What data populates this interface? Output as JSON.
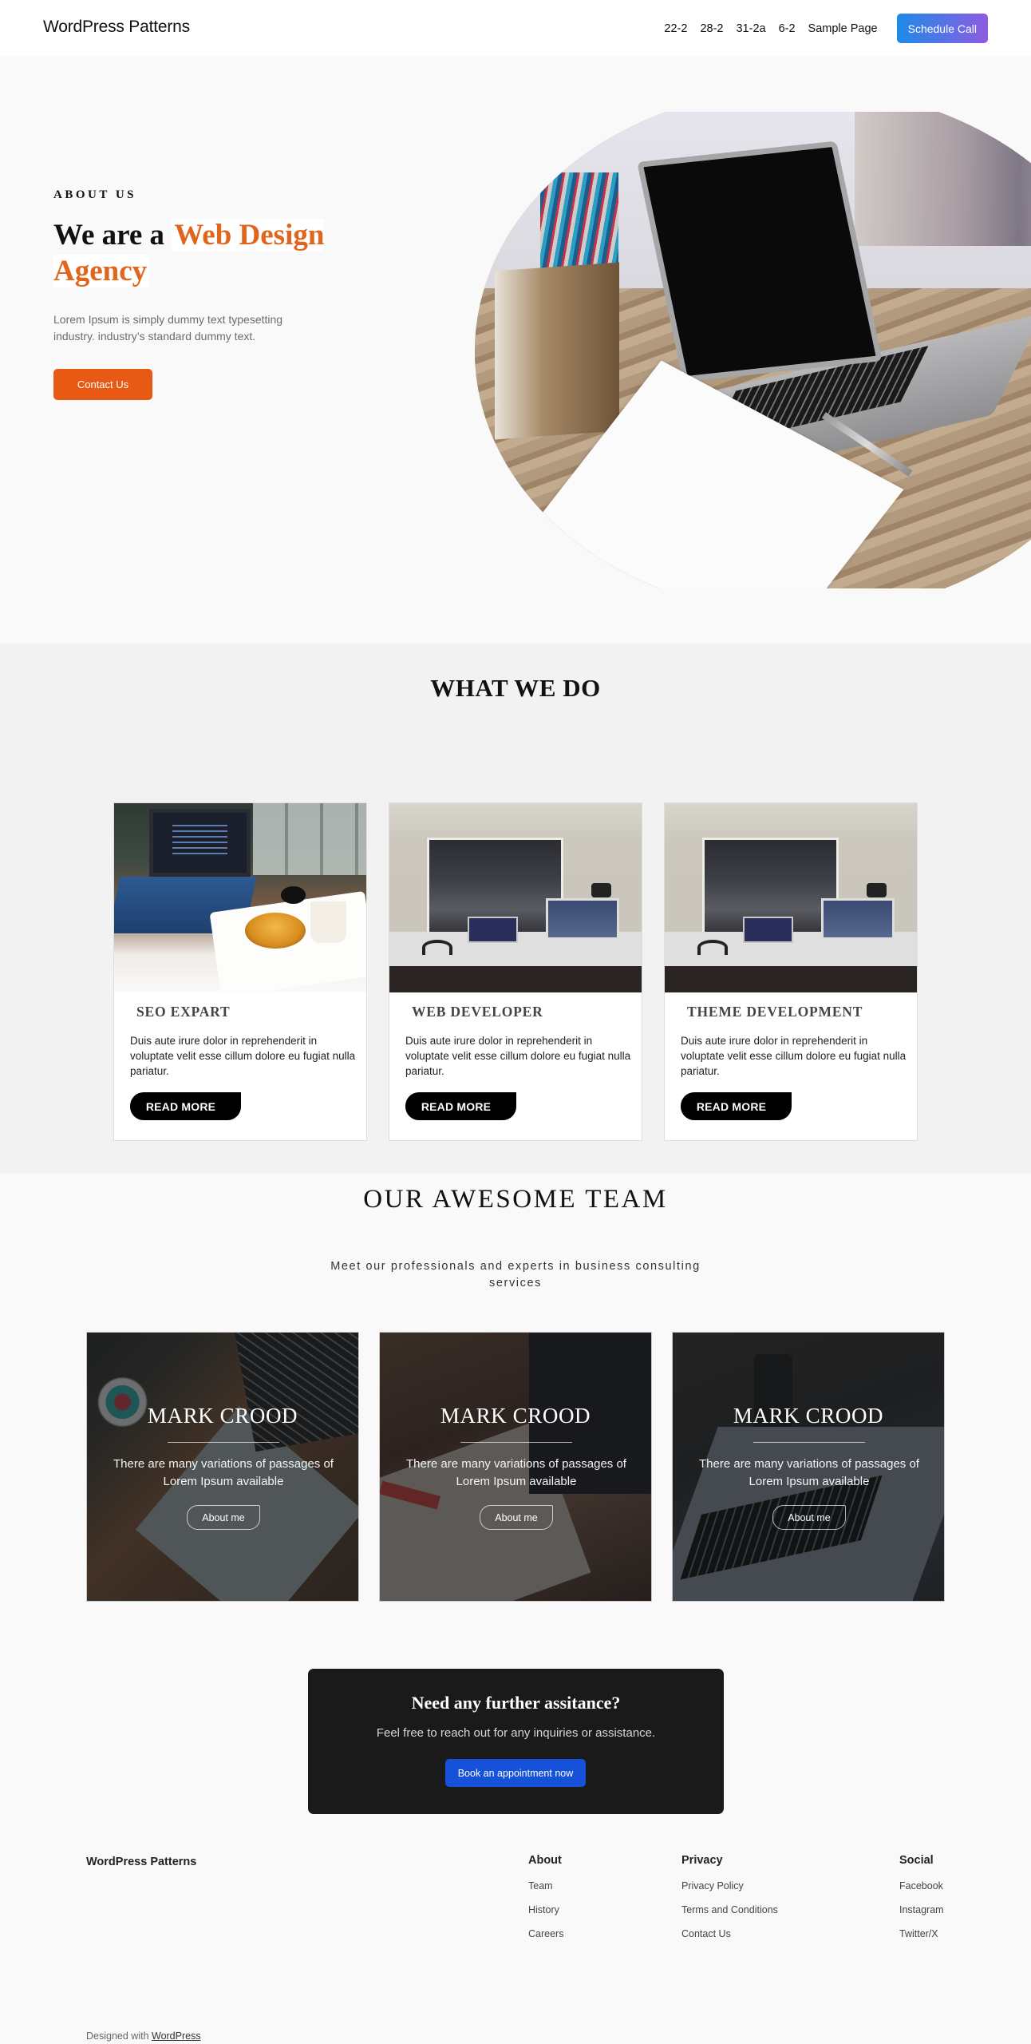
{
  "header": {
    "site_title": "WordPress Patterns",
    "nav": [
      "22-2",
      "28-2",
      "31-2a",
      "6-2",
      "Sample Page"
    ],
    "cta_label": "Schedule Call"
  },
  "hero": {
    "eyebrow": "ABOUT US",
    "title_prefix": "We are a ",
    "title_accent": "Web Design Agency",
    "description": "Lorem Ipsum is simply dummy text typesetting industry. industry’s standard dummy text.",
    "button_label": "Contact Us",
    "image_alt": "Laptop on wooden desk with paper, pen and pencil holder"
  },
  "services": {
    "title": "WHAT WE DO",
    "cards": [
      {
        "title": "SEO EXPART",
        "text": "Duis aute irure dolor in reprehenderit in voluptate velit esse cillum dolore eu fugiat nulla pariatur.",
        "button_label": "READ MORE"
      },
      {
        "title": "WEB DEVELOPER",
        "text": "Duis aute irure dolor in reprehenderit in voluptate velit esse cillum dolore eu fugiat nulla pariatur.",
        "button_label": "READ MORE"
      },
      {
        "title": "THEME DEVELOPMENT",
        "text": "Duis aute irure dolor in reprehenderit in voluptate velit esse cillum dolore eu fugiat nulla pariatur.",
        "button_label": "READ MORE"
      }
    ]
  },
  "team": {
    "title": "OUR AWESOME TEAM",
    "subtitle": "Meet our professionals and experts in business consulting services",
    "members": [
      {
        "name": "MARK CROOD",
        "bio": "There are many variations of passages of Lorem Ipsum available",
        "button_label": "About me"
      },
      {
        "name": "MARK CROOD",
        "bio": "There are many variations of passages of Lorem Ipsum available",
        "button_label": "About me"
      },
      {
        "name": "MARK CROOD",
        "bio": "There are many variations of passages of Lorem Ipsum available",
        "button_label": "About me"
      }
    ]
  },
  "cta": {
    "title": "Need any further assitance?",
    "text": "Feel free to reach out for any inquiries or assistance.",
    "button_label": "Book an appointment now"
  },
  "footer": {
    "brand": "WordPress Patterns",
    "columns": [
      {
        "heading": "About",
        "links": [
          "Team",
          "History",
          "Careers"
        ]
      },
      {
        "heading": "Privacy",
        "links": [
          "Privacy Policy",
          "Terms and Conditions",
          "Contact Us"
        ]
      },
      {
        "heading": "Social",
        "links": [
          "Facebook",
          "Instagram",
          "Twitter/X"
        ]
      }
    ],
    "credit_prefix": "Designed with ",
    "credit_link": "WordPress"
  },
  "colors": {
    "accent_orange": "#e85a14",
    "title_accent": "#e0661e",
    "cta_blue": "#1652d9",
    "schedule_gradient_start": "#1e8ae6",
    "schedule_gradient_end": "#8d5ce0",
    "cta_box_bg": "#1a1a1a"
  }
}
